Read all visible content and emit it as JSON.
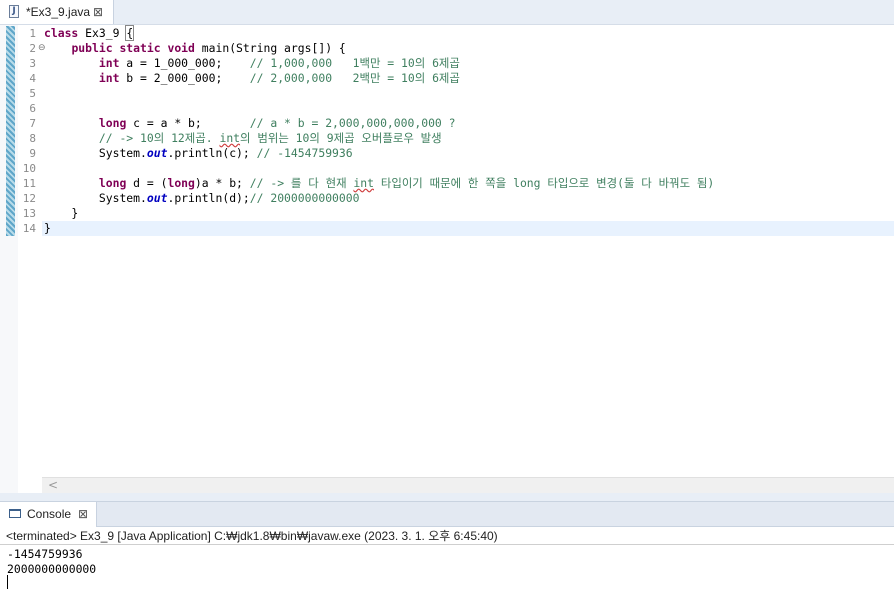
{
  "editor_tab": {
    "icon_letter": "J",
    "title": "*Ex3_9.java",
    "close_glyph": "⊠"
  },
  "editor": {
    "fold_marker": "⊖",
    "line_numbers": [
      "1",
      "2",
      "3",
      "4",
      "5",
      "6",
      "7",
      "8",
      "9",
      "10",
      "11",
      "12",
      "13",
      "14"
    ],
    "lines": {
      "l1": {
        "kw": "class",
        "rest": " Ex3_9 ",
        "brace": "{"
      },
      "l2": {
        "indent": "    ",
        "kw1": "public",
        "sp1": " ",
        "kw2": "static",
        "sp2": " ",
        "kw3": "void",
        "rest": " main(String args[]) {"
      },
      "l3": {
        "indent": "        ",
        "kw": "int",
        "code": " a = 1_000_000;    ",
        "comment": "// 1,000,000   1백만 = 10의 6제곱"
      },
      "l4": {
        "indent": "        ",
        "kw": "int",
        "code": " b = 2_000_000;    ",
        "comment": "// 2,000,000   2백만 = 10의 6제곱"
      },
      "l7": {
        "indent": "        ",
        "kw": "long",
        "code": " c = a * b;       ",
        "comment": "// a * b = 2,000,000,000,000 ?"
      },
      "l8": {
        "indent": "        ",
        "comment_a": "// -> 10의 12제곱. ",
        "comment_sq": "int",
        "comment_b": "의 범위는 10의 9제곱 오버플로우 발생"
      },
      "l9": {
        "indent": "        ",
        "code_a": "System.",
        "static_field": "out",
        "code_b": ".println(c); ",
        "comment": "// -1454759936"
      },
      "l11": {
        "indent": "        ",
        "kw": "long",
        "code_a": " d = (",
        "kw2": "long",
        "code_b": ")a * b; ",
        "comment_a": "// -> 를 다 현재 ",
        "comment_sq": "int",
        "comment_b": " 타입이기 때문에 한 쪽을 long 타입으로 변경(둘 다 바꿔도 됨)"
      },
      "l12": {
        "indent": "        ",
        "code_a": "System.",
        "static_field": "out",
        "code_b": ".println(d);",
        "comment": "// 2000000000000"
      },
      "l13": {
        "text": "    }"
      },
      "l14": {
        "text": "}"
      }
    },
    "scroll_left_glyph": "<"
  },
  "console": {
    "tab_title": "Console",
    "close_glyph": "⊠",
    "status": "<terminated> Ex3_9 [Java Application] C:₩jdk1.8₩bin₩javaw.exe (2023. 3. 1. 오후 6:45:40)",
    "output": [
      "-1454759936",
      "2000000000000"
    ]
  },
  "colors": {
    "keyword": "#7f0055",
    "comment": "#3f7f5f",
    "static_field": "#0000c0",
    "current_line": "#e8f2fe",
    "tab_bar": "#e8eef6"
  }
}
